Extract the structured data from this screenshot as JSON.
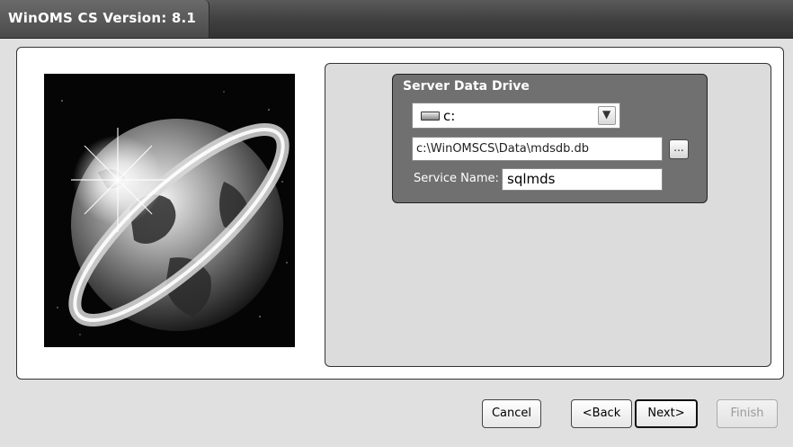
{
  "window": {
    "title": "WinOMS CS Version: 8.1"
  },
  "server_data_drive": {
    "title": "Server Data Drive",
    "drive": {
      "selected": "c:",
      "icon": "hard-drive-icon"
    },
    "path": "c:\\WinOMSCS\\Data\\mdsdb.db",
    "browse_label": "...",
    "service_name_label": "Service Name:",
    "service_name_value": "sqlmds"
  },
  "buttons": {
    "cancel": "Cancel",
    "back": "<Back",
    "next": "Next>",
    "finish": "Finish"
  },
  "icons": {
    "dropdown": "chevron-down-icon",
    "image": "globe-image"
  }
}
